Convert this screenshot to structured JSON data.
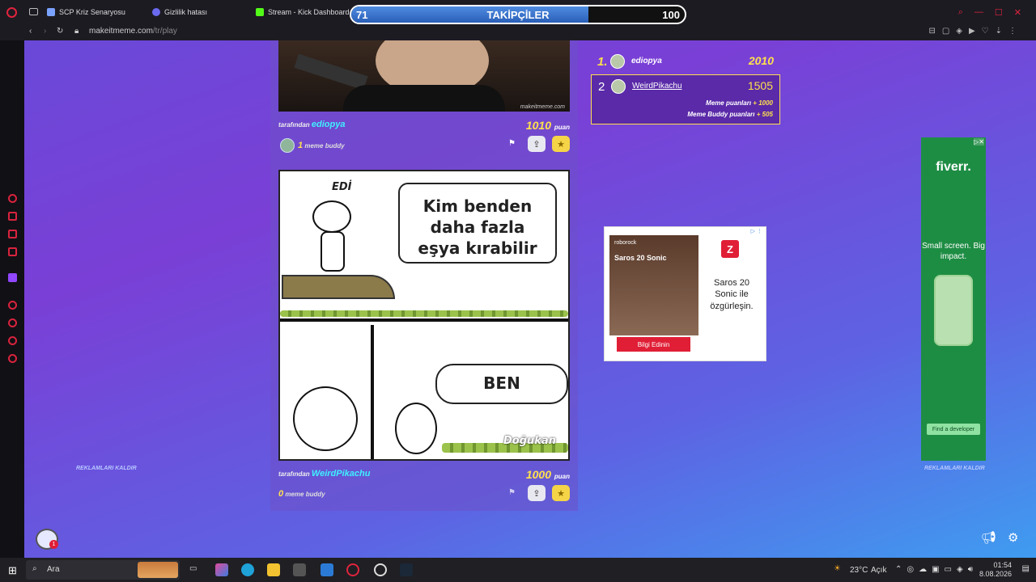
{
  "browser": {
    "tabs": [
      {
        "label": "SCP Kriz Senaryosu",
        "color": "#7aa2ff"
      },
      {
        "label": "Gizlilik hatası",
        "color": "#6a6af0"
      },
      {
        "label": "Stream - Kick Dashboard",
        "color": "#53fc18"
      }
    ],
    "url_domain": "makeitmeme.com",
    "url_path": "/tr/play"
  },
  "follower_bar": {
    "current": "71",
    "label": "TAKİPÇİLER",
    "goal": "100",
    "fill_fraction": 0.71
  },
  "feed": {
    "post1": {
      "by_prefix": "tarafından",
      "user": "ediopya",
      "score": "1010",
      "score_unit": "puan",
      "buddy_count": "1",
      "buddy_label": "meme buddy"
    },
    "post2": {
      "by_prefix": "tarafından",
      "user": "WeirdPikachu",
      "score": "1000",
      "score_unit": "puan",
      "buddy_count": "0",
      "buddy_label": "meme buddy"
    },
    "comic": {
      "name_top": "EDİ",
      "bubble1": "Kim benden daha fazla eşya kırabilir",
      "bubble2": "BEN",
      "name_bottom": "Doğukan",
      "watermark": "makeitmeme.com"
    }
  },
  "leaderboard": {
    "first": {
      "rank": "1.",
      "name": "ediopya",
      "score": "2010"
    },
    "second": {
      "rank": "2",
      "name": "WeirdPikachu",
      "score": "1505",
      "meme_label": "Meme puanları",
      "meme_val": "+ 1000",
      "buddy_label": "Meme Buddy puanları",
      "buddy_val": "+ 505"
    }
  },
  "ad_roborock": {
    "brand": "roborock",
    "title": "Saros 20 Sonic",
    "logo": "Z",
    "text": "Saros 20 Sonic ile özgürleşin.",
    "cta": "Bilgi Edinin"
  },
  "ad_fiverr": {
    "logo": "fiverr.",
    "tagline": "Small screen. Big impact.",
    "cta": "Find a developer"
  },
  "remove_ads_label": "REKLAMLARI KALDIR",
  "chat_badge": "1",
  "taskbar": {
    "search": "Ara",
    "weather": "23°C",
    "weather_state": "Açık",
    "time": "01:54",
    "date": "8.08.2026"
  }
}
